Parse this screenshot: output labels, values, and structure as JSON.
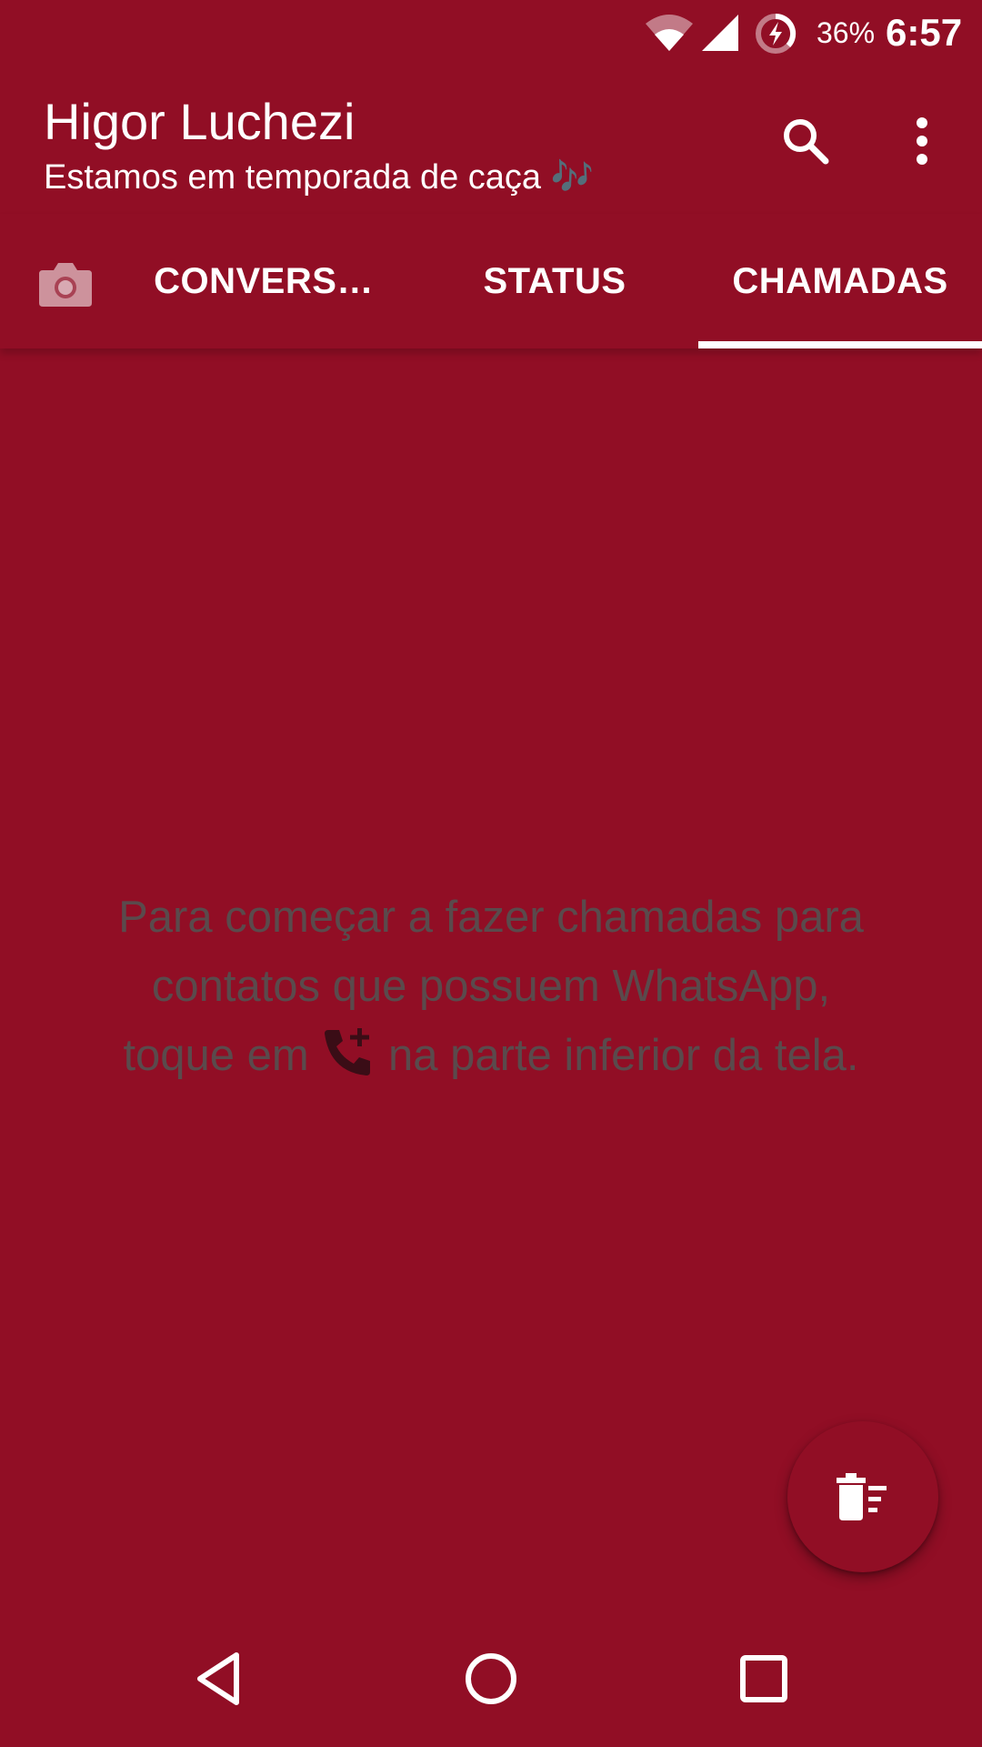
{
  "status_bar": {
    "battery_percent": "36%",
    "time": "6:57",
    "icons": [
      "wifi-icon",
      "signal-icon",
      "battery-charging-icon"
    ]
  },
  "header": {
    "title": "Higor Luchezi",
    "subtitle": "Estamos em temporada de caça 🎶",
    "icons": [
      "search-icon",
      "more-vert-icon"
    ]
  },
  "tabs": {
    "camera_icon": "camera-icon",
    "items": [
      {
        "label": "CONVERS…"
      },
      {
        "label": "STATUS"
      },
      {
        "label": "CHAMADAS",
        "selected": true
      }
    ]
  },
  "empty_state": {
    "line1": "Para começar a fazer chamadas para",
    "line2": "contatos que possuem WhatsApp,",
    "line3_before": "toque em",
    "line3_icon": "add-call-icon",
    "line3_after": "na parte inferior da tela."
  },
  "fab": {
    "icon": "clear-call-log-icon"
  },
  "nav_bar": {
    "icons": [
      "back-icon",
      "home-icon",
      "recents-icon"
    ]
  },
  "colors": {
    "primary": "#910e25",
    "text_on_primary": "#ffffff",
    "empty_text": "#5a4a4c"
  }
}
